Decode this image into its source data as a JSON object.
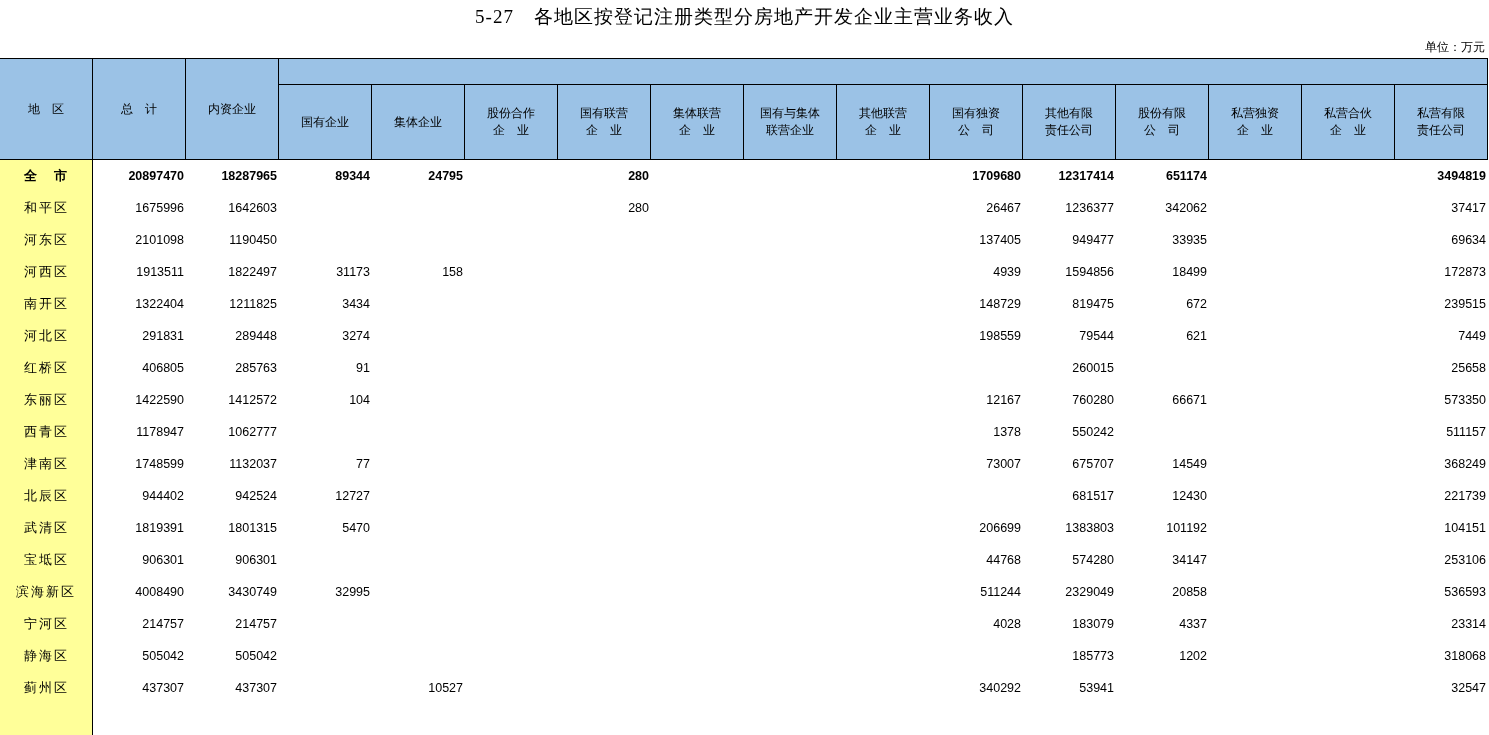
{
  "title": "5-27　各地区按登记注册类型分房地产开发企业主营业务收入",
  "unit": "单位：万元",
  "table": {
    "columns": [
      {
        "lines": [
          "地　区"
        ]
      },
      {
        "lines": [
          "总　计"
        ]
      },
      {
        "lines": [
          "内资企业"
        ]
      },
      {
        "lines": [
          "国有企业"
        ]
      },
      {
        "lines": [
          "集体企业"
        ]
      },
      {
        "lines": [
          "股份合作",
          "企　业"
        ]
      },
      {
        "lines": [
          "国有联营",
          "企　业"
        ]
      },
      {
        "lines": [
          "集体联营",
          "企　业"
        ]
      },
      {
        "lines": [
          "国有与集体",
          "联营企业"
        ]
      },
      {
        "lines": [
          "其他联营",
          "企　业"
        ]
      },
      {
        "lines": [
          "国有独资",
          "公　司"
        ]
      },
      {
        "lines": [
          "其他有限",
          "责任公司"
        ]
      },
      {
        "lines": [
          "股份有限",
          "公　司"
        ]
      },
      {
        "lines": [
          "私营独资",
          "企　业"
        ]
      },
      {
        "lines": [
          "私营合伙",
          "企　业"
        ]
      },
      {
        "lines": [
          "私营有限",
          "责任公司"
        ]
      }
    ],
    "rows": [
      {
        "kind": "total",
        "region": "全　市",
        "total": "20897470",
        "domestic": "18287965",
        "state_owned": "89344",
        "collective": "24795",
        "state_joint": "280",
        "state_sole": "1709680",
        "other_llc": "12317414",
        "joint_stock_ltd": "651174",
        "private_llc": "3494819"
      },
      {
        "kind": "district",
        "region": "和平区",
        "total": "1675996",
        "domestic": "1642603",
        "state_joint": "280",
        "state_sole": "26467",
        "other_llc": "1236377",
        "joint_stock_ltd": "342062",
        "private_llc": "37417"
      },
      {
        "kind": "district",
        "region": "河东区",
        "total": "2101098",
        "domestic": "1190450",
        "state_sole": "137405",
        "other_llc": "949477",
        "joint_stock_ltd": "33935",
        "private_llc": "69634"
      },
      {
        "kind": "district",
        "region": "河西区",
        "total": "1913511",
        "domestic": "1822497",
        "state_owned": "31173",
        "collective": "158",
        "state_sole": "4939",
        "other_llc": "1594856",
        "joint_stock_ltd": "18499",
        "private_llc": "172873"
      },
      {
        "kind": "district",
        "region": "南开区",
        "total": "1322404",
        "domestic": "1211825",
        "state_owned": "3434",
        "state_sole": "148729",
        "other_llc": "819475",
        "joint_stock_ltd": "672",
        "private_llc": "239515"
      },
      {
        "kind": "district",
        "region": "河北区",
        "total": "291831",
        "domestic": "289448",
        "state_owned": "3274",
        "state_sole": "198559",
        "other_llc": "79544",
        "joint_stock_ltd": "621",
        "private_llc": "7449"
      },
      {
        "kind": "district",
        "region": "红桥区",
        "total": "406805",
        "domestic": "285763",
        "state_owned": "91",
        "other_llc": "260015",
        "private_llc": "25658"
      },
      {
        "kind": "district",
        "region": "东丽区",
        "total": "1422590",
        "domestic": "1412572",
        "state_owned": "104",
        "state_sole": "12167",
        "other_llc": "760280",
        "joint_stock_ltd": "66671",
        "private_llc": "573350"
      },
      {
        "kind": "district",
        "region": "西青区",
        "total": "1178947",
        "domestic": "1062777",
        "state_sole": "1378",
        "other_llc": "550242",
        "private_llc": "511157"
      },
      {
        "kind": "district",
        "region": "津南区",
        "total": "1748599",
        "domestic": "1132037",
        "state_owned": "77",
        "state_sole": "73007",
        "other_llc": "675707",
        "joint_stock_ltd": "14549",
        "private_llc": "368249"
      },
      {
        "kind": "district",
        "region": "北辰区",
        "total": "944402",
        "domestic": "942524",
        "state_owned": "12727",
        "other_llc": "681517",
        "joint_stock_ltd": "12430",
        "private_llc": "221739"
      },
      {
        "kind": "district",
        "region": "武清区",
        "total": "1819391",
        "domestic": "1801315",
        "state_owned": "5470",
        "state_sole": "206699",
        "other_llc": "1383803",
        "joint_stock_ltd": "101192",
        "private_llc": "104151"
      },
      {
        "kind": "district",
        "region": "宝坻区",
        "total": "906301",
        "domestic": "906301",
        "state_sole": "44768",
        "other_llc": "574280",
        "joint_stock_ltd": "34147",
        "private_llc": "253106"
      },
      {
        "kind": "district",
        "region": "滨海新区",
        "total": "4008490",
        "domestic": "3430749",
        "state_owned": "32995",
        "state_sole": "511244",
        "other_llc": "2329049",
        "joint_stock_ltd": "20858",
        "private_llc": "536593"
      },
      {
        "kind": "district",
        "region": "宁河区",
        "total": "214757",
        "domestic": "214757",
        "state_sole": "4028",
        "other_llc": "183079",
        "joint_stock_ltd": "4337",
        "private_llc": "23314"
      },
      {
        "kind": "district",
        "region": "静海区",
        "total": "505042",
        "domestic": "505042",
        "other_llc": "185773",
        "joint_stock_ltd": "1202",
        "private_llc": "318068"
      },
      {
        "kind": "district",
        "region": "蓟州区",
        "total": "437307",
        "domestic": "437307",
        "collective": "10527",
        "state_sole": "340292",
        "other_llc": "53941",
        "private_llc": "32547"
      }
    ]
  }
}
